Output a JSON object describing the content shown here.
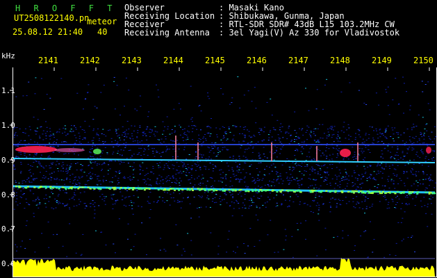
{
  "header": {
    "app_name": "H R O F F T",
    "filename": "UT2508122140.pn",
    "suffix": "meteor",
    "datetime": "25.08.12 21:40",
    "count": "40"
  },
  "info": {
    "observer_label": "Observer",
    "observer_value": ": Masaki Kano",
    "location_label": "Receiving Location",
    "location_value": ": Shibukawa, Gunma, Japan",
    "receiver_label": "Receiver",
    "receiver_value": ": RTL-SDR SDR# 43dB L15 103.2MHz CW",
    "antenna_label": "Receiving Antenna",
    "antenna_value": ": 3el Yagi(V) Az 330 for Vladivostok"
  },
  "axes": {
    "y_unit": "kHz",
    "y_ticks": [
      "1.1",
      "1.0",
      "0.9",
      "0.8",
      "0.7",
      "0.6"
    ],
    "x_ticks": [
      "2141",
      "2142",
      "2143",
      "2144",
      "2145",
      "2146",
      "2147",
      "2148",
      "2149",
      "2150"
    ]
  },
  "colors": {
    "background": "#000000",
    "text_yellow": "#ffff00",
    "text_white": "#ffffff",
    "title_green": "#40e040",
    "spectrum_blue": "#1e2cff",
    "echo_red": "#ff2050"
  }
}
